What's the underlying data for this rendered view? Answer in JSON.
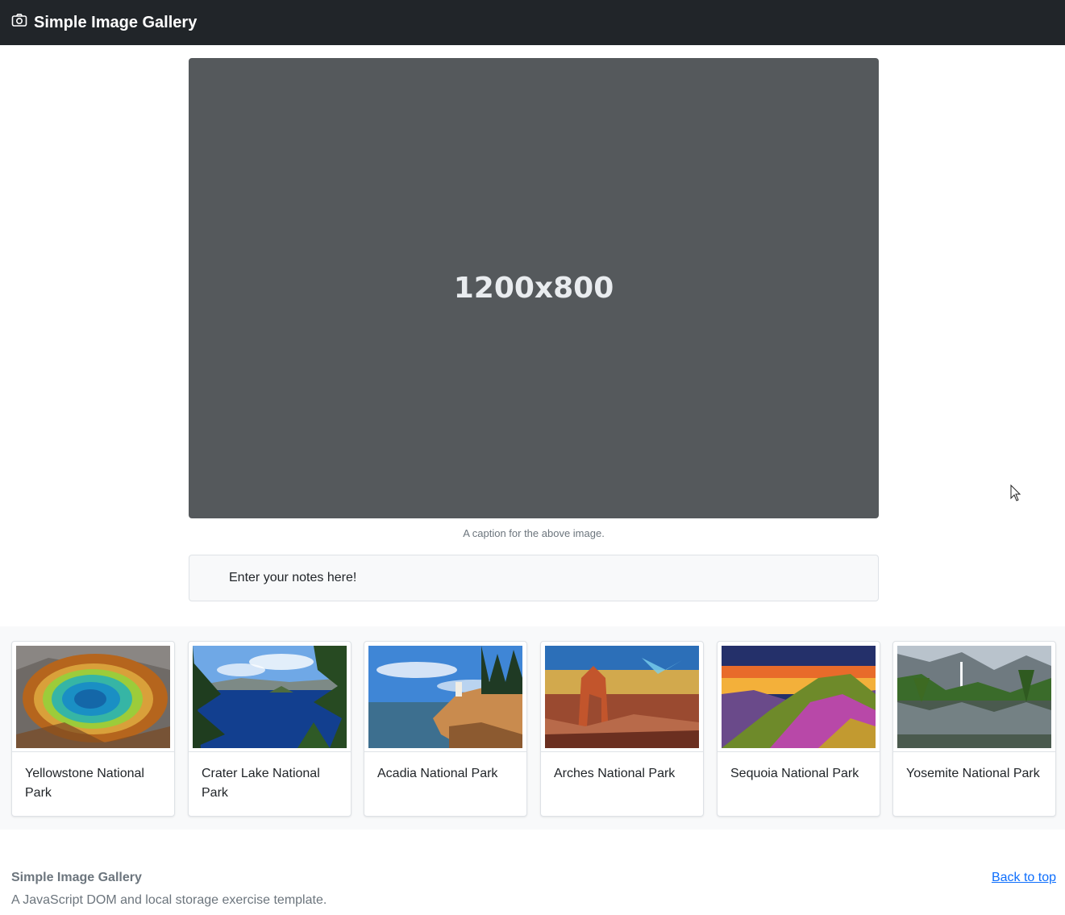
{
  "navbar": {
    "brand": "Simple Image Gallery",
    "icon": "camera-icon"
  },
  "main": {
    "placeholder_text": "1200x800",
    "caption": "A caption for the above image.",
    "notes_placeholder": "Enter your notes here!"
  },
  "gallery": [
    {
      "title": "Yellowstone National Park",
      "image": "yellowstone-hot-spring"
    },
    {
      "title": "Crater Lake National Park",
      "image": "crater-lake"
    },
    {
      "title": "Acadia National Park",
      "image": "acadia-lighthouse-coast"
    },
    {
      "title": "Arches National Park",
      "image": "delicate-arch-sunset"
    },
    {
      "title": "Sequoia National Park",
      "image": "sequoia-sunset-hills"
    },
    {
      "title": "Yosemite National Park",
      "image": "yosemite-valley-reflection"
    }
  ],
  "footer": {
    "title": "Simple Image Gallery",
    "description": "A JavaScript DOM and local storage exercise template.",
    "back_to_top": "Back to top"
  },
  "colors": {
    "navbar_bg": "#212529",
    "placeholder_bg": "#55595c",
    "link": "#0d6efd",
    "muted": "#6c757d"
  }
}
